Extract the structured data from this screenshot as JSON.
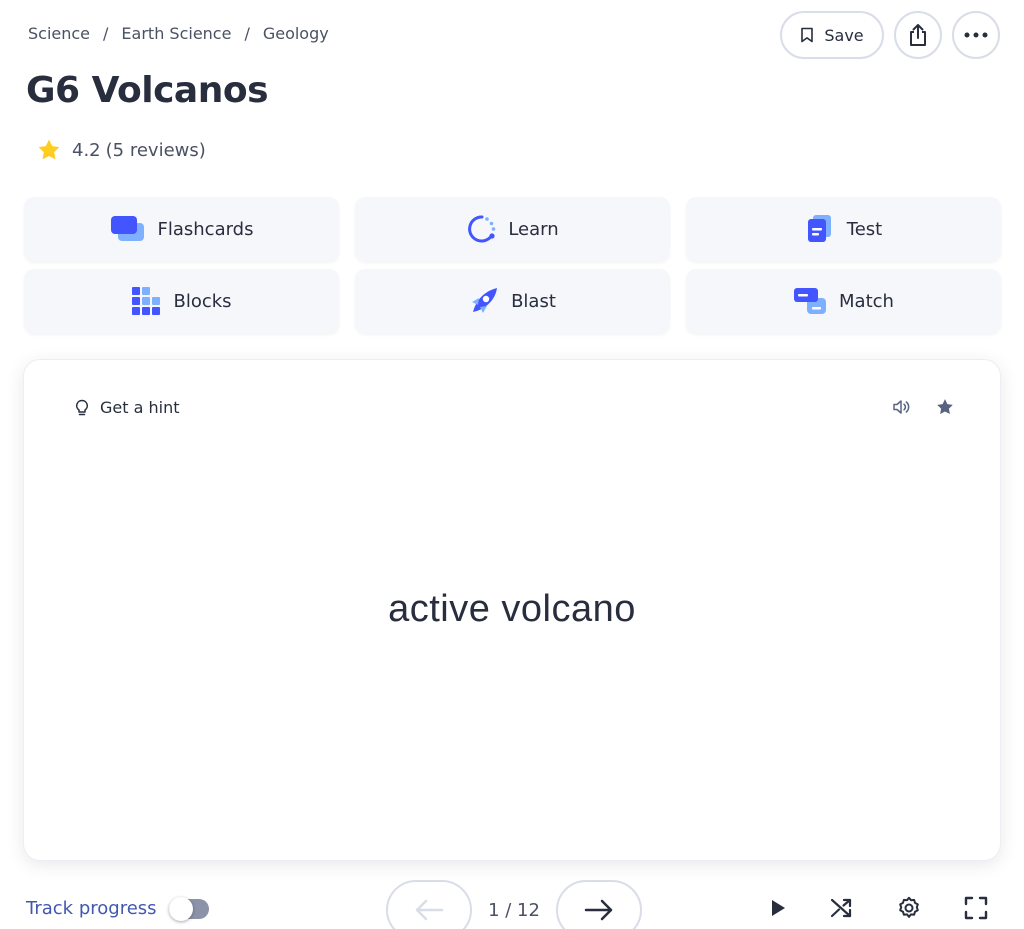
{
  "breadcrumb": {
    "items": [
      "Science",
      "Earth Science",
      "Geology"
    ],
    "separator": "/"
  },
  "header": {
    "save_label": "Save",
    "title": "G6 Volcanos"
  },
  "rating": {
    "value": "4.2",
    "reviews": "(5 reviews)",
    "star_color": "#ffcd1f"
  },
  "modes": [
    {
      "label": "Flashcards",
      "icon": "flashcards-icon"
    },
    {
      "label": "Learn",
      "icon": "learn-icon"
    },
    {
      "label": "Test",
      "icon": "test-icon"
    },
    {
      "label": "Blocks",
      "icon": "blocks-icon"
    },
    {
      "label": "Blast",
      "icon": "blast-icon"
    },
    {
      "label": "Match",
      "icon": "match-icon"
    }
  ],
  "card": {
    "hint_label": "Get a hint",
    "term": "active volcano"
  },
  "footer": {
    "track_label": "Track progress",
    "counter": "1 / 12"
  },
  "colors": {
    "accent": "#4255ff",
    "link": "#4257b2",
    "text": "#282e3e"
  }
}
